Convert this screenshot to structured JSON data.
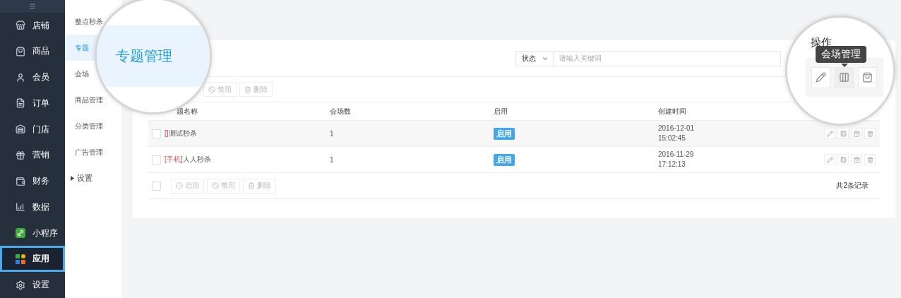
{
  "sidebar": {
    "items": [
      {
        "label": "店铺",
        "selected": false
      },
      {
        "label": "商品",
        "selected": false
      },
      {
        "label": "会员",
        "selected": false
      },
      {
        "label": "订单",
        "selected": false
      },
      {
        "label": "门店",
        "selected": false
      },
      {
        "label": "营销",
        "selected": false
      },
      {
        "label": "财务",
        "selected": false
      },
      {
        "label": "数据",
        "selected": false
      },
      {
        "label": "小程序",
        "selected": false
      },
      {
        "label": "应用",
        "selected": true
      },
      {
        "label": "设置",
        "selected": false
      }
    ]
  },
  "submenu": {
    "items": [
      {
        "kind": "item",
        "label": "整点秒杀",
        "selected": false
      },
      {
        "kind": "item",
        "label": "专题",
        "selected": true
      },
      {
        "kind": "item",
        "label": "会场",
        "selected": false
      },
      {
        "kind": "item",
        "label": "商品管理",
        "selected": false
      },
      {
        "kind": "item",
        "label": "分类管理",
        "selected": false
      },
      {
        "kind": "item",
        "label": "广告管理",
        "selected": false
      },
      {
        "kind": "group",
        "label": "设置",
        "expanded": false
      }
    ]
  },
  "magnifier_left": {
    "text": "专题管理"
  },
  "search": {
    "select": "状态",
    "placeholder": "请输入关键词"
  },
  "toolbar": [
    {
      "kind": "disable",
      "label": "禁用",
      "disabled": true
    },
    {
      "kind": "delete",
      "label": "删除",
      "disabled": true
    }
  ],
  "table": {
    "columns": [
      "题名称",
      "会场数",
      "启用",
      "创建时间"
    ],
    "rows": [
      {
        "checked": false,
        "prefix": "[]",
        "name": "测试秒杀",
        "venues": "1",
        "status": "启用",
        "date": "2016-12-01",
        "time": "15:02:45"
      },
      {
        "checked": false,
        "prefix": "[手机]",
        "name": "人人秒杀",
        "venues": "1",
        "status": "启用",
        "date": "2016-11-29",
        "time": "17:12:13"
      }
    ]
  },
  "footer": {
    "checked": false,
    "buttons": [
      {
        "kind": "enable",
        "label": "启用",
        "disabled": true
      },
      {
        "kind": "disable",
        "label": "禁用",
        "disabled": true
      },
      {
        "kind": "delete",
        "label": "删除",
        "disabled": true
      }
    ],
    "total": "共2条记录"
  },
  "magnifier_right": {
    "column": "操作",
    "tooltip": "会场管理",
    "actions": [
      {
        "selected": false
      },
      {
        "selected": true
      },
      {
        "selected": false
      }
    ]
  }
}
